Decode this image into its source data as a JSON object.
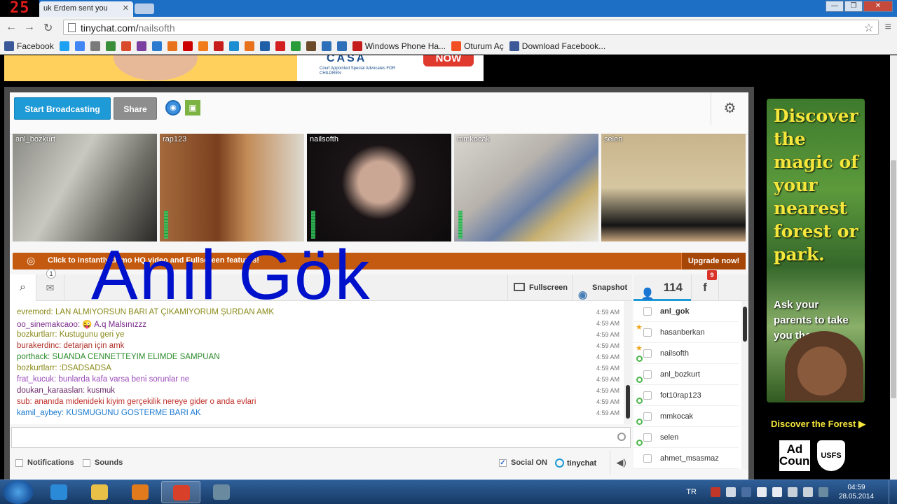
{
  "recording_counter": "25",
  "browser": {
    "tab_title": "uk Erdem sent you",
    "url_domain": "tinychat.com/",
    "url_path": "nailsofth",
    "bookmarks": [
      {
        "label": "Facebook",
        "color": "#3b5998"
      },
      {
        "label": "",
        "color": "#1da1f2"
      },
      {
        "label": "",
        "color": "#4285f4"
      },
      {
        "label": "",
        "color": "#7a7a7a"
      },
      {
        "label": "",
        "color": "#3a8e3a"
      },
      {
        "label": "",
        "color": "#d94a2b"
      },
      {
        "label": "",
        "color": "#7b3fa0"
      },
      {
        "label": "",
        "color": "#2a7ad0"
      },
      {
        "label": "",
        "color": "#e8721c"
      },
      {
        "label": "",
        "color": "#cc0000"
      },
      {
        "label": "",
        "color": "#f07c1b"
      },
      {
        "label": "",
        "color": "#c71c1c"
      },
      {
        "label": "",
        "color": "#1c8ed1"
      },
      {
        "label": "",
        "color": "#e8721c"
      },
      {
        "label": "",
        "color": "#1f5fa8"
      },
      {
        "label": "",
        "color": "#d31f1f"
      },
      {
        "label": "",
        "color": "#2a9d3a"
      },
      {
        "label": "",
        "color": "#6b4a2a"
      },
      {
        "label": "",
        "color": "#2d6fb8"
      },
      {
        "label": "",
        "color": "#2d6fb8"
      },
      {
        "label": "Windows Phone Ha...",
        "color": "#c41b1b"
      },
      {
        "label": "Oturum Aç",
        "color": "#f25022"
      },
      {
        "label": "Download Facebook...",
        "color": "#3b5998"
      }
    ]
  },
  "ad_top": {
    "brand": "CASA",
    "tagline": "Court Appointed Special Advocates FOR CHILDREN",
    "cta": "NOW"
  },
  "toolbar": {
    "broadcast_label": "Start Broadcasting",
    "share_label": "Share"
  },
  "videos": [
    {
      "name": "anl_bozkurt"
    },
    {
      "name": "rap123"
    },
    {
      "name": "nailsofth"
    },
    {
      "name": "mmkocak"
    },
    {
      "name": "selen"
    }
  ],
  "promo": {
    "text": "Click to instantly demo HQ video and Fullscreen features!",
    "upgrade_label": "Upgrade now!"
  },
  "chat_toolbar": {
    "pm_badge": "1",
    "fullscreen_label": "Fullscreen",
    "snapshot_label": "Snapshot"
  },
  "messages": [
    {
      "user": "evremord:",
      "text": "LAN ALMIYORSUN BARI  AT  ÇIKAMIYORUM ŞURDAN AMK",
      "time": "4:59 AM",
      "color": "#8a8a1a"
    },
    {
      "user": "oo_sinemakcaoo:",
      "text": "😜 A.q Malsınızzz",
      "time": "4:59 AM",
      "color": "#7a2a8a"
    },
    {
      "user": "bozkurtlarr:",
      "text": "Kustugunu geri ye",
      "time": "4:59 AM",
      "color": "#8a8a1a"
    },
    {
      "user": "burakerdinc:",
      "text": "detarjan için amk",
      "time": "4:59 AM",
      "color": "#b0302a"
    },
    {
      "user": "porthack:",
      "text": "SUANDA CENNETTEYIM ELIMDE SAMPUAN",
      "time": "4:59 AM",
      "color": "#2a8a2a"
    },
    {
      "user": "bozkurtlarr:",
      "text": ":DSADSADSA",
      "time": "4:59 AM",
      "color": "#8a8a1a"
    },
    {
      "user": "frat_kucuk:",
      "text": "bunlarda  kafa varsa beni sorunlar ne",
      "time": "4:59 AM",
      "color": "#9a4ab8"
    },
    {
      "user": "doukan_karaaslan:",
      "text": "kusmuk",
      "time": "4:59 AM",
      "color": "#6a2a6a"
    },
    {
      "user": "sub:",
      "text": "ananıda midenideki kiyim gerçekilik nereye gider o anda evlari",
      "time": "4:59 AM",
      "color": "#c0302a"
    },
    {
      "user": "kamil_aybey:",
      "text": "KUSMUGUNU GOSTERME BARI AK",
      "time": "4:59 AM",
      "color": "#1a7ad0"
    }
  ],
  "watermark": "Anıl Gök",
  "chat_input": {
    "placeholder": ""
  },
  "bottom": {
    "notifications_label": "Notifications",
    "sounds_label": "Sounds",
    "social_label": "Social ON",
    "logo_label": "tinychat"
  },
  "userlist": {
    "count": "114",
    "fb_label": "f",
    "fb_badge": "9",
    "users": [
      {
        "name": "anl_gok",
        "bold": true,
        "star": false,
        "cam": false
      },
      {
        "name": "hasanberkan",
        "bold": false,
        "star": true,
        "cam": false
      },
      {
        "name": "nailsofth",
        "bold": false,
        "star": true,
        "cam": true
      },
      {
        "name": "anl_bozkurt",
        "bold": false,
        "star": false,
        "cam": true
      },
      {
        "name": "fot10rap123",
        "bold": false,
        "star": false,
        "cam": true
      },
      {
        "name": "mmkocak",
        "bold": false,
        "star": false,
        "cam": true
      },
      {
        "name": "selen",
        "bold": false,
        "star": false,
        "cam": true
      },
      {
        "name": "ahmet_msasmaz",
        "bold": false,
        "star": false,
        "cam": false
      }
    ]
  },
  "ad_right": {
    "headline": "Discover the magic of your nearest forest or park.",
    "subtext": "Ask your parents to take you there.",
    "cta": "Discover the Forest ▶",
    "logo1": "Ad Council",
    "logo2": "USFS"
  },
  "taskbar": {
    "lang": "TR",
    "time": "04:59",
    "date": "28.05.2014",
    "apps": [
      {
        "name": "internet-explorer",
        "color": "#2a8ad8",
        "active": false
      },
      {
        "name": "file-explorer",
        "color": "#e8c048",
        "active": false
      },
      {
        "name": "media-player",
        "color": "#e07a1c",
        "active": false
      },
      {
        "name": "chrome",
        "color": "#d8402a",
        "active": true
      },
      {
        "name": "recorder",
        "color": "#6a8aa0",
        "active": false
      }
    ]
  }
}
